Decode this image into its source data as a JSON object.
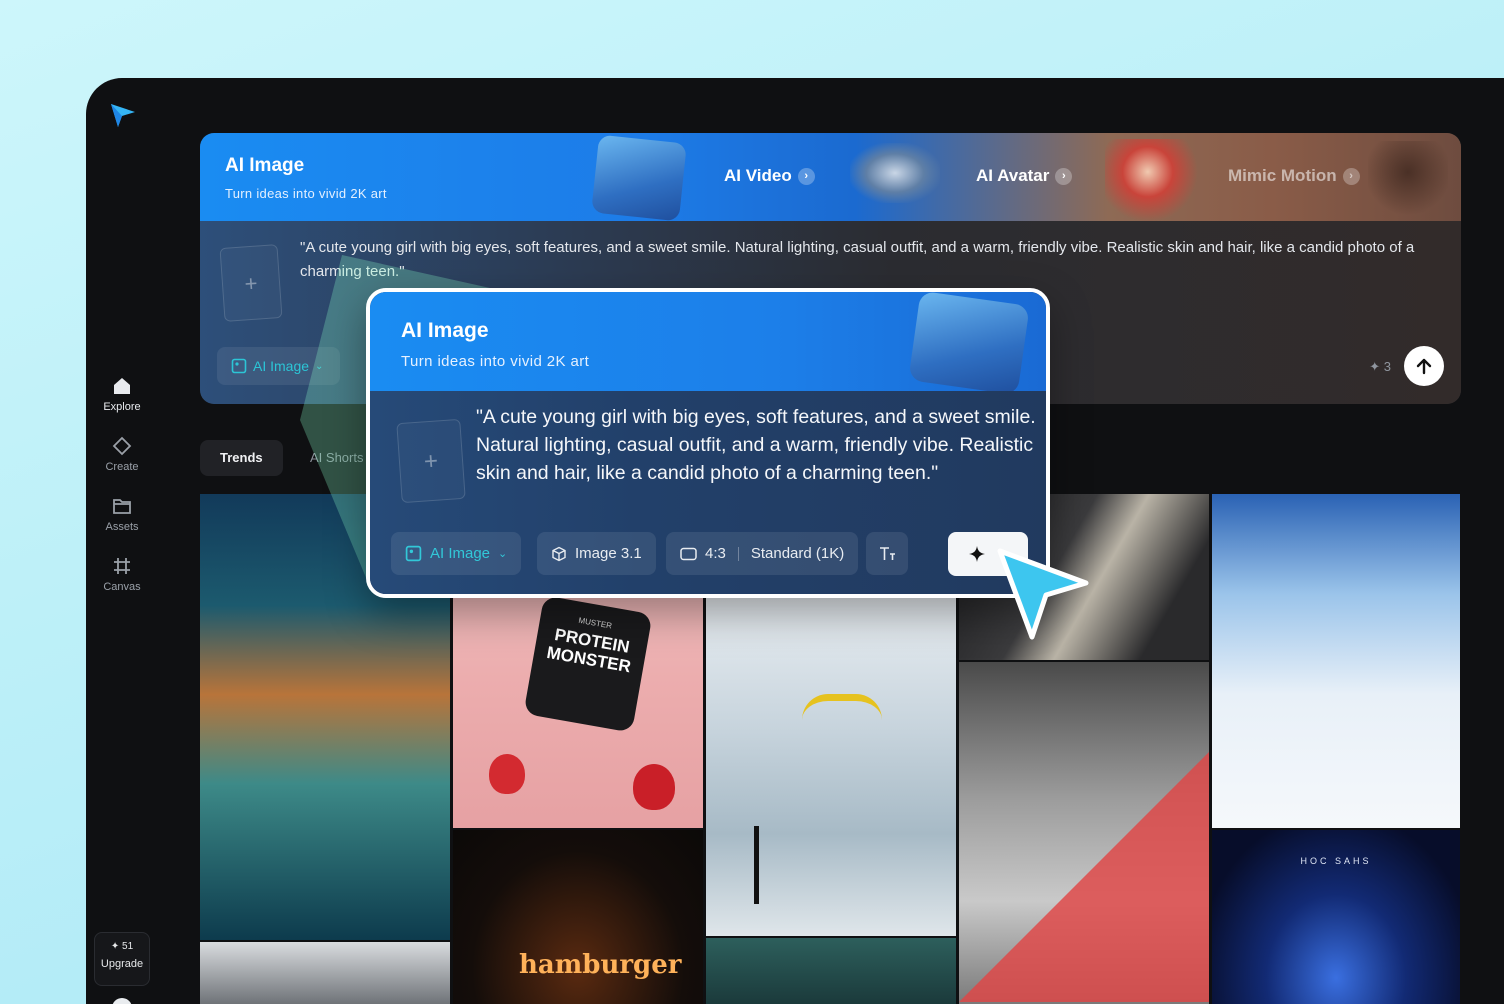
{
  "sidebar": {
    "items": [
      {
        "label": "Explore",
        "icon": "home-icon"
      },
      {
        "label": "Create",
        "icon": "diamond-icon"
      },
      {
        "label": "Assets",
        "icon": "folder-icon"
      },
      {
        "label": "Canvas",
        "icon": "canvas-icon"
      }
    ],
    "upgrade": {
      "credits": "✦ 51",
      "label": "Upgrade"
    }
  },
  "banner": {
    "title": "AI Image",
    "subtitle": "Turn ideas into vivid 2K art",
    "tabs": [
      "AI Video",
      "AI Avatar",
      "Mimic Motion"
    ],
    "prompt": "\"A cute young girl with big eyes, soft features, and a sweet smile. Natural lighting, casual outfit, and a warm, friendly vibe. Realistic skin and hair, like a candid photo of a charming teen.\"",
    "mode_chip": "AI Image",
    "credits": "✦ 3"
  },
  "feed_tabs": [
    "Trends",
    "AI Shorts"
  ],
  "popup": {
    "title": "AI Image",
    "subtitle": "Turn ideas into vivid 2K art",
    "prompt": "\"A cute young girl with big eyes, soft features, and a sweet smile. Natural lighting, casual outfit, and a warm, friendly vibe. Realistic skin and hair, like a candid photo of a charming teen.\"",
    "mode": "AI Image",
    "model": "Image 3.1",
    "ratio": "4:3",
    "quality": "Standard (1K)"
  },
  "gallery_text": {
    "product": "PROTEIN MONSTER",
    "product_brand": "MUSTER",
    "neon": "hamburger",
    "poster": "HOC SAHS"
  },
  "colors": {
    "accent": "#1a8cf2",
    "chip_text": "#2cc5d6",
    "app_bg": "#0f1012",
    "cursor": "#3dc6ef"
  }
}
